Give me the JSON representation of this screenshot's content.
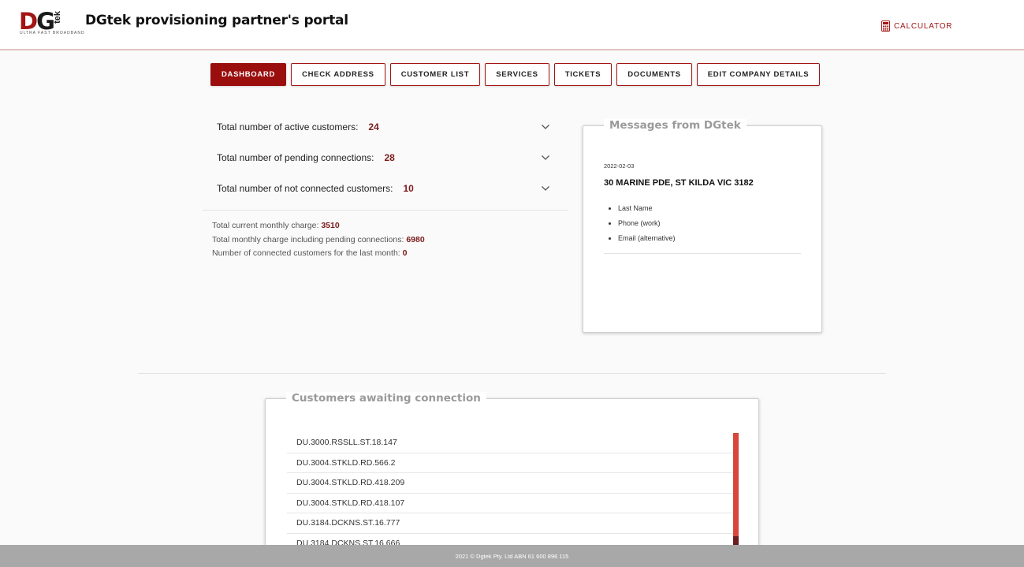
{
  "header": {
    "logo_text": "DGtek",
    "logo_sub": "ULTRA FAST BROADBAND",
    "title": "DGtek provisioning partner's portal",
    "calculator_label": "CALCULATOR",
    "calculator_icon": "calculator-icon",
    "accent": "#a31515"
  },
  "nav": {
    "tabs": [
      {
        "label": "DASHBOARD",
        "active": true
      },
      {
        "label": "CHECK ADDRESS",
        "active": false
      },
      {
        "label": "CUSTOMER LIST",
        "active": false
      },
      {
        "label": "SERVICES",
        "active": false
      },
      {
        "label": "TICKETS",
        "active": false
      },
      {
        "label": "DOCUMENTS",
        "active": false
      },
      {
        "label": "EDIT COMPANY DETAILS",
        "active": false
      }
    ]
  },
  "summary": {
    "rows": [
      {
        "label": "Total number of active customers:",
        "value": "24"
      },
      {
        "label": "Total number of pending connections:",
        "value": "28"
      },
      {
        "label": "Total number of not connected customers:",
        "value": "10"
      }
    ],
    "stats": [
      {
        "label": "Total current monthly charge:",
        "value": "3510"
      },
      {
        "label": "Total monthly charge including pending connections:",
        "value": "6980"
      },
      {
        "label": "Number of connected customers for the last month:",
        "value": "0"
      }
    ]
  },
  "messages": {
    "title": "Messages from DGtek",
    "date": "2022-02-03",
    "address": "30 MARINE PDE, ST KILDA VIC 3182",
    "items": [
      "Last Name",
      "Phone (work)",
      "Email (alternative)"
    ]
  },
  "awaiting": {
    "title": "Customers awaiting connection",
    "items": [
      "DU.3000.RSSLL.ST.18.147",
      "DU.3004.STKLD.RD.566.2",
      "DU.3004.STKLD.RD.418.209",
      "DU.3004.STKLD.RD.418.107",
      "DU.3184.DCKNS.ST.16.777",
      "DU.3184.DCKNS.ST.16.666"
    ]
  },
  "footer": {
    "text": "2021 © Dgtek Pty. Ltd ABN 61 600 896 115"
  }
}
